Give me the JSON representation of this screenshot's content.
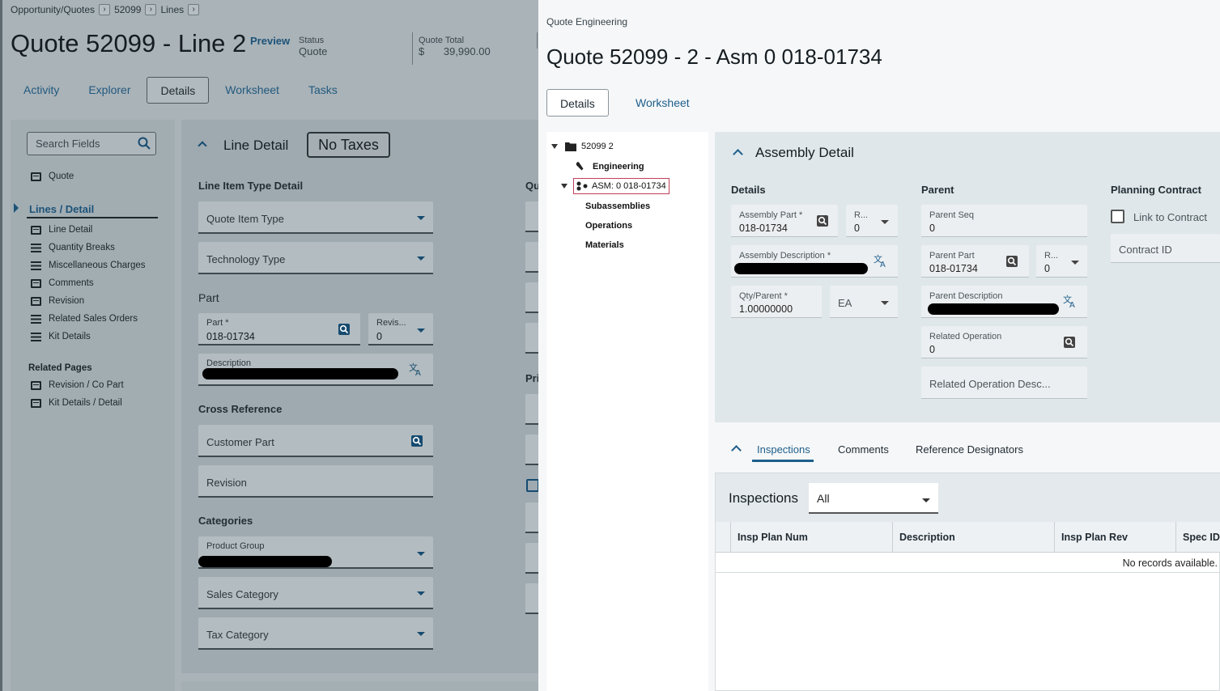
{
  "left": {
    "breadcrumbs": [
      "Opportunity/Quotes",
      "52099",
      "Lines"
    ],
    "title": "Quote 52099 - Line 2",
    "preview_label": "Preview",
    "status": {
      "label": "Status",
      "value": "Quote"
    },
    "quote_total": {
      "label": "Quote Total",
      "currency": "$",
      "value": "39,990.00"
    },
    "tabs": [
      "Activity",
      "Explorer",
      "Details",
      "Worksheet",
      "Tasks"
    ],
    "active_tab": "Details",
    "search_placeholder": "Search Fields",
    "nav": {
      "quote": "Quote",
      "lines_detail": "Lines / Detail",
      "items": [
        "Line Detail",
        "Quantity Breaks",
        "Miscellaneous Charges",
        "Comments",
        "Revision",
        "Related Sales Orders",
        "Kit Details"
      ],
      "related_pages_label": "Related Pages",
      "related": [
        "Revision / Co Part",
        "Kit Details / Detail"
      ]
    },
    "line_detail": {
      "title": "Line Detail",
      "no_taxes": "No Taxes",
      "line_item_type_label": "Line Item Type Detail",
      "quote_item_type": "Quote Item Type",
      "technology_type": "Technology Type",
      "part_label": "Part",
      "part_field_label": "Part *",
      "part_value": "018-01734",
      "revision_field_label": "Revis...",
      "revision_value": "0",
      "description_label": "Description",
      "cross_ref_label": "Cross Reference",
      "customer_part": "Customer Part",
      "revision": "Revision",
      "categories_label": "Categories",
      "product_group": "Product Group",
      "sales_category": "Sales Category",
      "tax_category": "Tax Category",
      "qu_label": "Qua",
      "pri_label": "Pri"
    }
  },
  "right": {
    "app_label": "Quote Engineering",
    "title": "Quote 52099 - 2 - Asm 0 018-01734",
    "tabs": [
      "Details",
      "Worksheet"
    ],
    "tree": {
      "root": "52099 2",
      "engineering": "Engineering",
      "asm": "ASM: 0 018-01734",
      "children": [
        "Subassemblies",
        "Operations",
        "Materials"
      ]
    },
    "assembly": {
      "title": "Assembly Detail",
      "details_label": "Details",
      "parent_label": "Parent",
      "planning_label": "Planning Contract",
      "assembly_part_label": "Assembly Part *",
      "assembly_part_value": "018-01734",
      "rev_label": "R...",
      "rev_value": "0",
      "assembly_desc_label": "Assembly Description *",
      "qty_parent_label": "Qty/Parent *",
      "qty_parent_value": "1.00000000",
      "uom_value": "EA",
      "parent_seq_label": "Parent Seq",
      "parent_seq_value": "0",
      "parent_part_label": "Parent Part",
      "parent_part_value": "018-01734",
      "parent_rev_label": "R...",
      "parent_rev_value": "0",
      "parent_desc_label": "Parent Description",
      "related_op_label": "Related Operation",
      "related_op_value": "0",
      "related_op_desc": "Related Operation Desc...",
      "link_contract": "Link to Contract",
      "contract_id": "Contract ID"
    },
    "subtabs": [
      "Inspections",
      "Comments",
      "Reference Designators"
    ],
    "inspections": {
      "title": "Inspections",
      "filter_value": "All",
      "columns": [
        "Insp Plan Num",
        "Description",
        "Insp Plan Rev",
        "Spec ID"
      ],
      "empty_text": "No records available."
    }
  },
  "colors": {
    "accent": "#1d5e8c",
    "overlay_bg": "#a9b3b8",
    "panel_bg": "#f6f7f8"
  }
}
